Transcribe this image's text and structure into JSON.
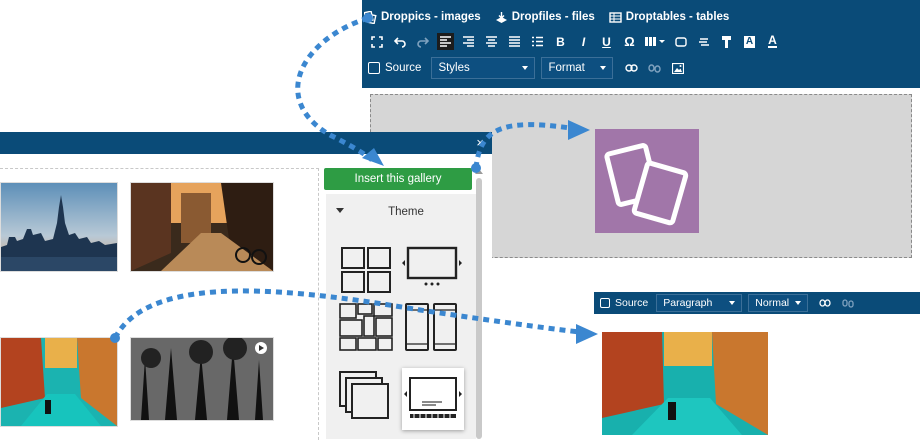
{
  "top_editor": {
    "plugins": [
      {
        "label": "Droppics - images",
        "icon": "droppics-icon"
      },
      {
        "label": "Dropfiles - files",
        "icon": "dropfiles-icon"
      },
      {
        "label": "Droptables - tables",
        "icon": "droptables-icon"
      }
    ],
    "toolbar_buttons": [
      "fullscreen-icon",
      "undo-icon",
      "redo-icon",
      "align-left-icon",
      "align-right-icon",
      "align-center-icon",
      "align-justify-icon",
      "list-icon",
      "bold",
      "italic",
      "underline",
      "omega-icon",
      "columns-icon",
      "box-icon",
      "strike-icon",
      "paint-icon",
      "bg-color-icon",
      "text-color-icon"
    ],
    "glyphs": {
      "bold": "B",
      "italic": "I",
      "underline": "U",
      "omega": "Ω",
      "bg_a": "A",
      "text_a": "A"
    },
    "source_label": "Source",
    "styles_value": "Styles",
    "format_value": "Format"
  },
  "gallery": {
    "close_symbol": "×",
    "insert_button": "Insert this gallery",
    "theme_title": "Theme"
  },
  "bottom_editor": {
    "source_label": "Source",
    "paragraph_value": "Paragraph",
    "normal_value": "Normal"
  },
  "colors": {
    "toolbar": "#0a4b78",
    "insert_button": "#2e9c44",
    "droppics_tile": "#a176a9",
    "arrow": "#3b87d0"
  }
}
